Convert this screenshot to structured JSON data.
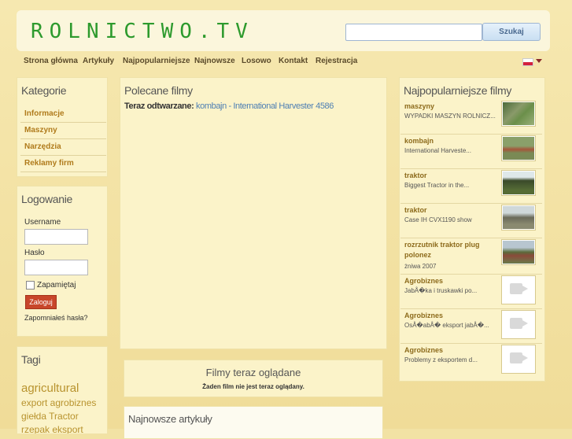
{
  "header": {
    "logo": "ROLNICTWO.TV",
    "search_placeholder": "",
    "search_button": "Szukaj"
  },
  "nav": {
    "items": [
      "Strona główna",
      "Artykuły",
      "Najpopularniejsze",
      "Najnowsze",
      "Losowo",
      "Kontakt",
      "Rejestracja"
    ]
  },
  "categories": {
    "title": "Kategorie",
    "items": [
      "Informacje",
      "Maszyny",
      "Narzędzia",
      "Reklamy firm"
    ]
  },
  "login": {
    "title": "Logowanie",
    "username_label": "Username",
    "password_label": "Hasło",
    "remember_label": "Zapamiętaj",
    "submit": "Zaloguj",
    "forgot": "Zapomniałeś hasła?"
  },
  "tags": {
    "title": "Tagi",
    "items": [
      "agricultural",
      "export agrobiznes",
      "giełda Tractor",
      "rzepak eksport"
    ]
  },
  "featured": {
    "title": "Polecane filmy",
    "now_playing_label": "Teraz odtwarzane:",
    "now_playing_value": "kombajn - International Harvester 4586"
  },
  "watching": {
    "title": "Filmy teraz oglądane",
    "empty": "Żaden film nie jest teraz oglądany."
  },
  "latest_articles": {
    "title": "Najnowsze artykuły"
  },
  "popular": {
    "title": "Najpopularniejsze filmy",
    "films": [
      {
        "title": "maszyny",
        "desc": "WYPADKI MASZYN ROLNICZ...",
        "thumb": "photo"
      },
      {
        "title": "kombajn",
        "desc": "International Harveste...",
        "thumb": "photo"
      },
      {
        "title": "traktor",
        "desc": "Biggest Tractor in the...",
        "thumb": "photo"
      },
      {
        "title": "traktor",
        "desc": "Case IH CVX1190 show",
        "thumb": "photo"
      },
      {
        "title": "rozrzutnik traktor plug polonez",
        "desc": "żniwa 2007",
        "thumb": "photo"
      },
      {
        "title": "Agrobiznes",
        "desc": "JabÅ�ka i truskawki po...",
        "thumb": "video-placeholder-icon"
      },
      {
        "title": "Agrobiznes",
        "desc": "OsÅ�abÅ� eksport jabÅ�...",
        "thumb": "video-placeholder-icon"
      },
      {
        "title": "Agrobiznes",
        "desc": "Problemy z eksportem d...",
        "thumb": "video-placeholder-icon"
      }
    ]
  },
  "colors": {
    "logo": "#2d9a2d",
    "link": "#b07b1c",
    "accent": "#c8462a"
  }
}
